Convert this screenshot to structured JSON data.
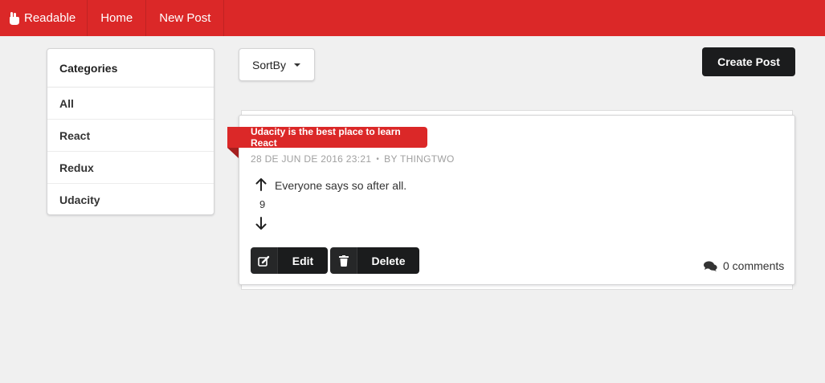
{
  "nav": {
    "brand": "Readable",
    "home": "Home",
    "new_post": "New Post"
  },
  "categories": {
    "header": "Categories",
    "items": [
      {
        "label": "All"
      },
      {
        "label": "React"
      },
      {
        "label": "Redux"
      },
      {
        "label": "Udacity"
      }
    ]
  },
  "sort": {
    "label": "SortBy"
  },
  "create_post_label": "Create Post",
  "post": {
    "title": "Udacity is the best place to learn React",
    "date": "28 DE JUN DE 2016 23:21",
    "separator": "•",
    "author": "BY THINGTWO",
    "body": "Everyone says so after all.",
    "score": "9",
    "edit_label": "Edit",
    "delete_label": "Delete",
    "comments": "0 comments"
  },
  "colors": {
    "accent": "#db2828",
    "dark_button": "#1b1c1d",
    "background": "#f0f0f0"
  },
  "icons": {
    "brand": "hand-peace-icon",
    "sort": "caret-down-icon",
    "vote_up": "arrow-up-icon",
    "vote_down": "arrow-down-icon",
    "edit": "edit-icon",
    "delete": "trash-icon",
    "comments": "comments-icon"
  }
}
